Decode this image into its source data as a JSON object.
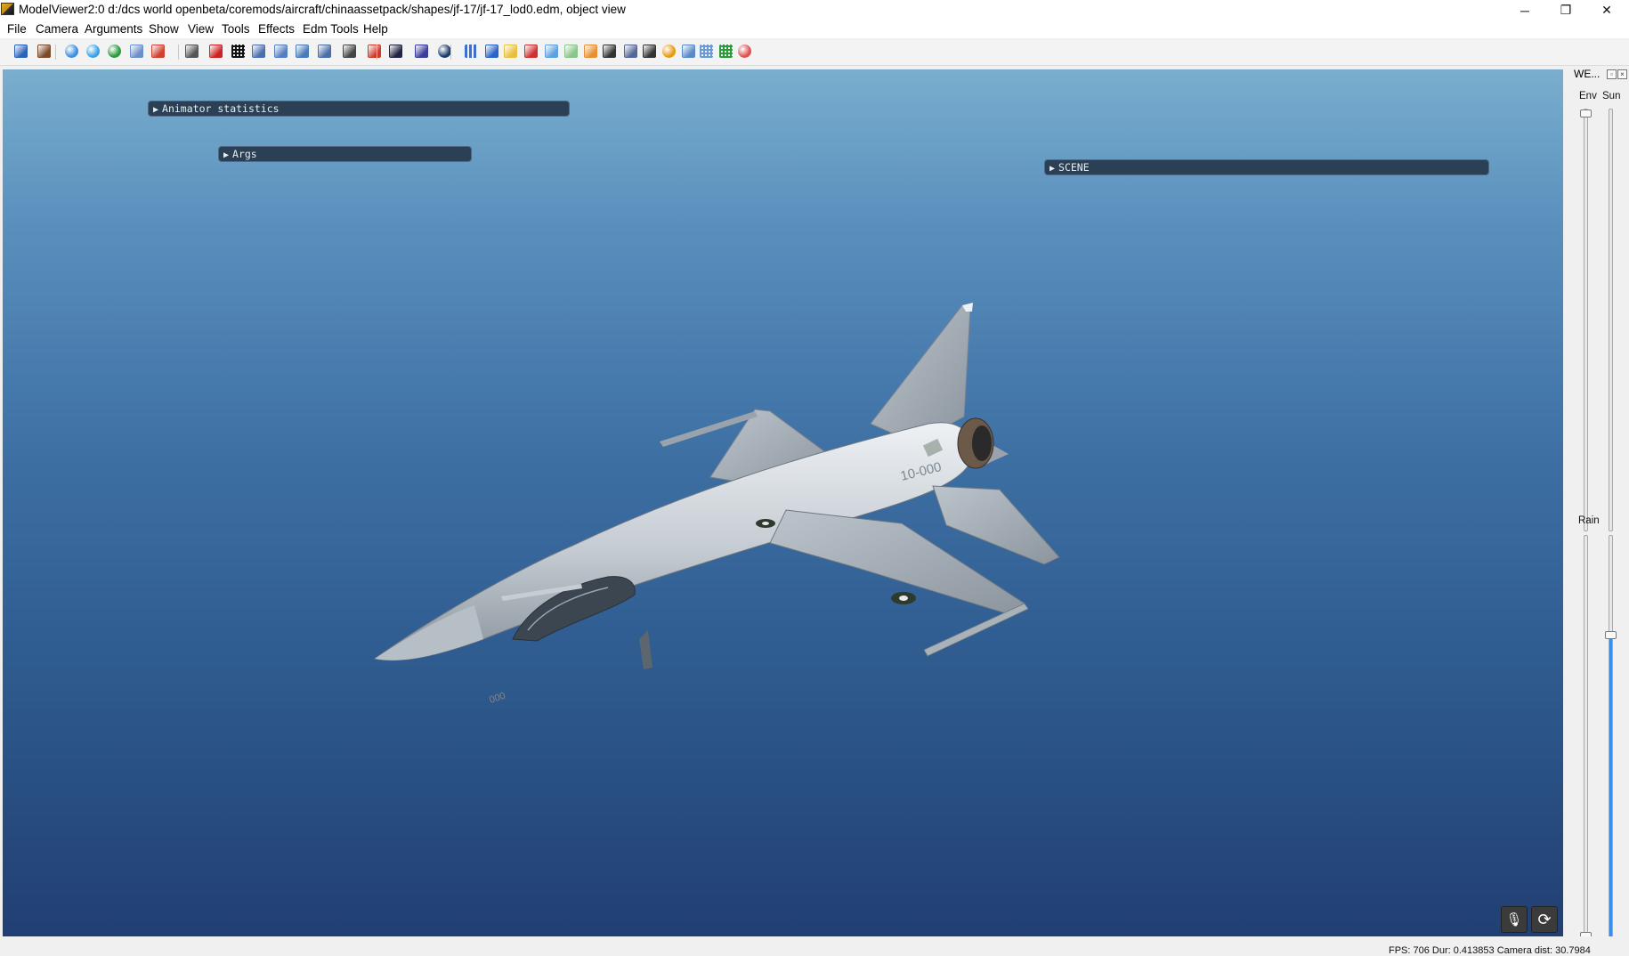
{
  "window": {
    "title": "ModelViewer2:0 d:/dcs world openbeta/coremods/aircraft/chinaassetpack/shapes/jf-17/jf-17_lod0.edm, object view",
    "minimize_glyph": "─",
    "maximize_glyph": "❐",
    "close_glyph": "✕"
  },
  "menu": {
    "items": [
      {
        "label": "File"
      },
      {
        "label": "Camera"
      },
      {
        "label": "Arguments"
      },
      {
        "label": "Show"
      },
      {
        "label": "View"
      },
      {
        "label": "Tools"
      },
      {
        "label": "Effects"
      },
      {
        "label": "Edm Tools"
      },
      {
        "label": "Help"
      }
    ]
  },
  "toolbar": {
    "icons": [
      {
        "name": "save-icon",
        "color": "#2a62b8"
      },
      {
        "name": "person-settings-icon",
        "color": "#7a4a2a"
      },
      {
        "name": "globe-icon",
        "color": "#3c8fe0"
      },
      {
        "name": "refresh-icon",
        "color": "#3aa0e8"
      },
      {
        "name": "reload-green-icon",
        "color": "#2a9a3a"
      },
      {
        "name": "image-icon",
        "color": "#6b8fc8"
      },
      {
        "name": "skeleton-icon",
        "color": "#d04030"
      },
      {
        "name": "camera-icon",
        "color": "#555555"
      },
      {
        "name": "crosshair-icon",
        "color": "#cc2222"
      },
      {
        "name": "grid-black-icon",
        "color": "#111111"
      },
      {
        "name": "funnel-icon",
        "color": "#4a6fb0"
      },
      {
        "name": "cone-icon",
        "color": "#5580c0"
      },
      {
        "name": "arrow-right-icon",
        "color": "#4a7ab8"
      },
      {
        "name": "speaker-icon",
        "color": "#4a6fa8"
      },
      {
        "name": "texture-icon",
        "color": "#444444"
      },
      {
        "name": "rgb-icon",
        "color": "#d03a2a"
      },
      {
        "name": "film-icon",
        "color": "#222244"
      },
      {
        "name": "undo-icon",
        "color": "#3b3b9a"
      },
      {
        "name": "dial-icon",
        "color": "#1a3a6a"
      },
      {
        "name": "bar-chart-icon",
        "color": "#3a6fd8"
      },
      {
        "name": "cube-blue-icon",
        "color": "#2a62c8"
      },
      {
        "name": "folders-icon",
        "color": "#e8c040"
      },
      {
        "name": "cube-red-icon",
        "color": "#d03030"
      },
      {
        "name": "cube-light-icon",
        "color": "#5fa0e0"
      },
      {
        "name": "cube-green-icon",
        "color": "#8ac48a"
      },
      {
        "name": "graph-icon",
        "color": "#e89030"
      },
      {
        "name": "figure-icon",
        "color": "#333333"
      },
      {
        "name": "stack-icon",
        "color": "#556699"
      },
      {
        "name": "car-icon",
        "color": "#333333"
      },
      {
        "name": "shell-icon",
        "color": "#e89a10"
      },
      {
        "name": "molecule-icon",
        "color": "#5a8ac8"
      },
      {
        "name": "grid-blue-icon",
        "color": "#6a9ad8"
      },
      {
        "name": "grid-green-icon",
        "color": "#2a9a3a"
      },
      {
        "name": "record-icon",
        "color": "#e05050"
      }
    ]
  },
  "viewport": {
    "panels": {
      "animator_label": "Animator statistics",
      "args_label": "Args",
      "scene_label": "SCENE",
      "arrow": "▶"
    },
    "aircraft": {
      "tail_number": "10-000",
      "nose_number": "000"
    },
    "mic_icon": "🎙",
    "cycle_icon": "⟳"
  },
  "dock": {
    "title": "WE...",
    "labels": {
      "env": "Env",
      "sun": "Sun",
      "rain": "Rain"
    },
    "sliders": {
      "env": 0,
      "sun": 0,
      "rain": 0.98
    },
    "fill_color": "#3a8ee6"
  },
  "statusbar": {
    "text": "FPS: 706  Dur: 0.413853  Camera dist: 30.7984"
  }
}
